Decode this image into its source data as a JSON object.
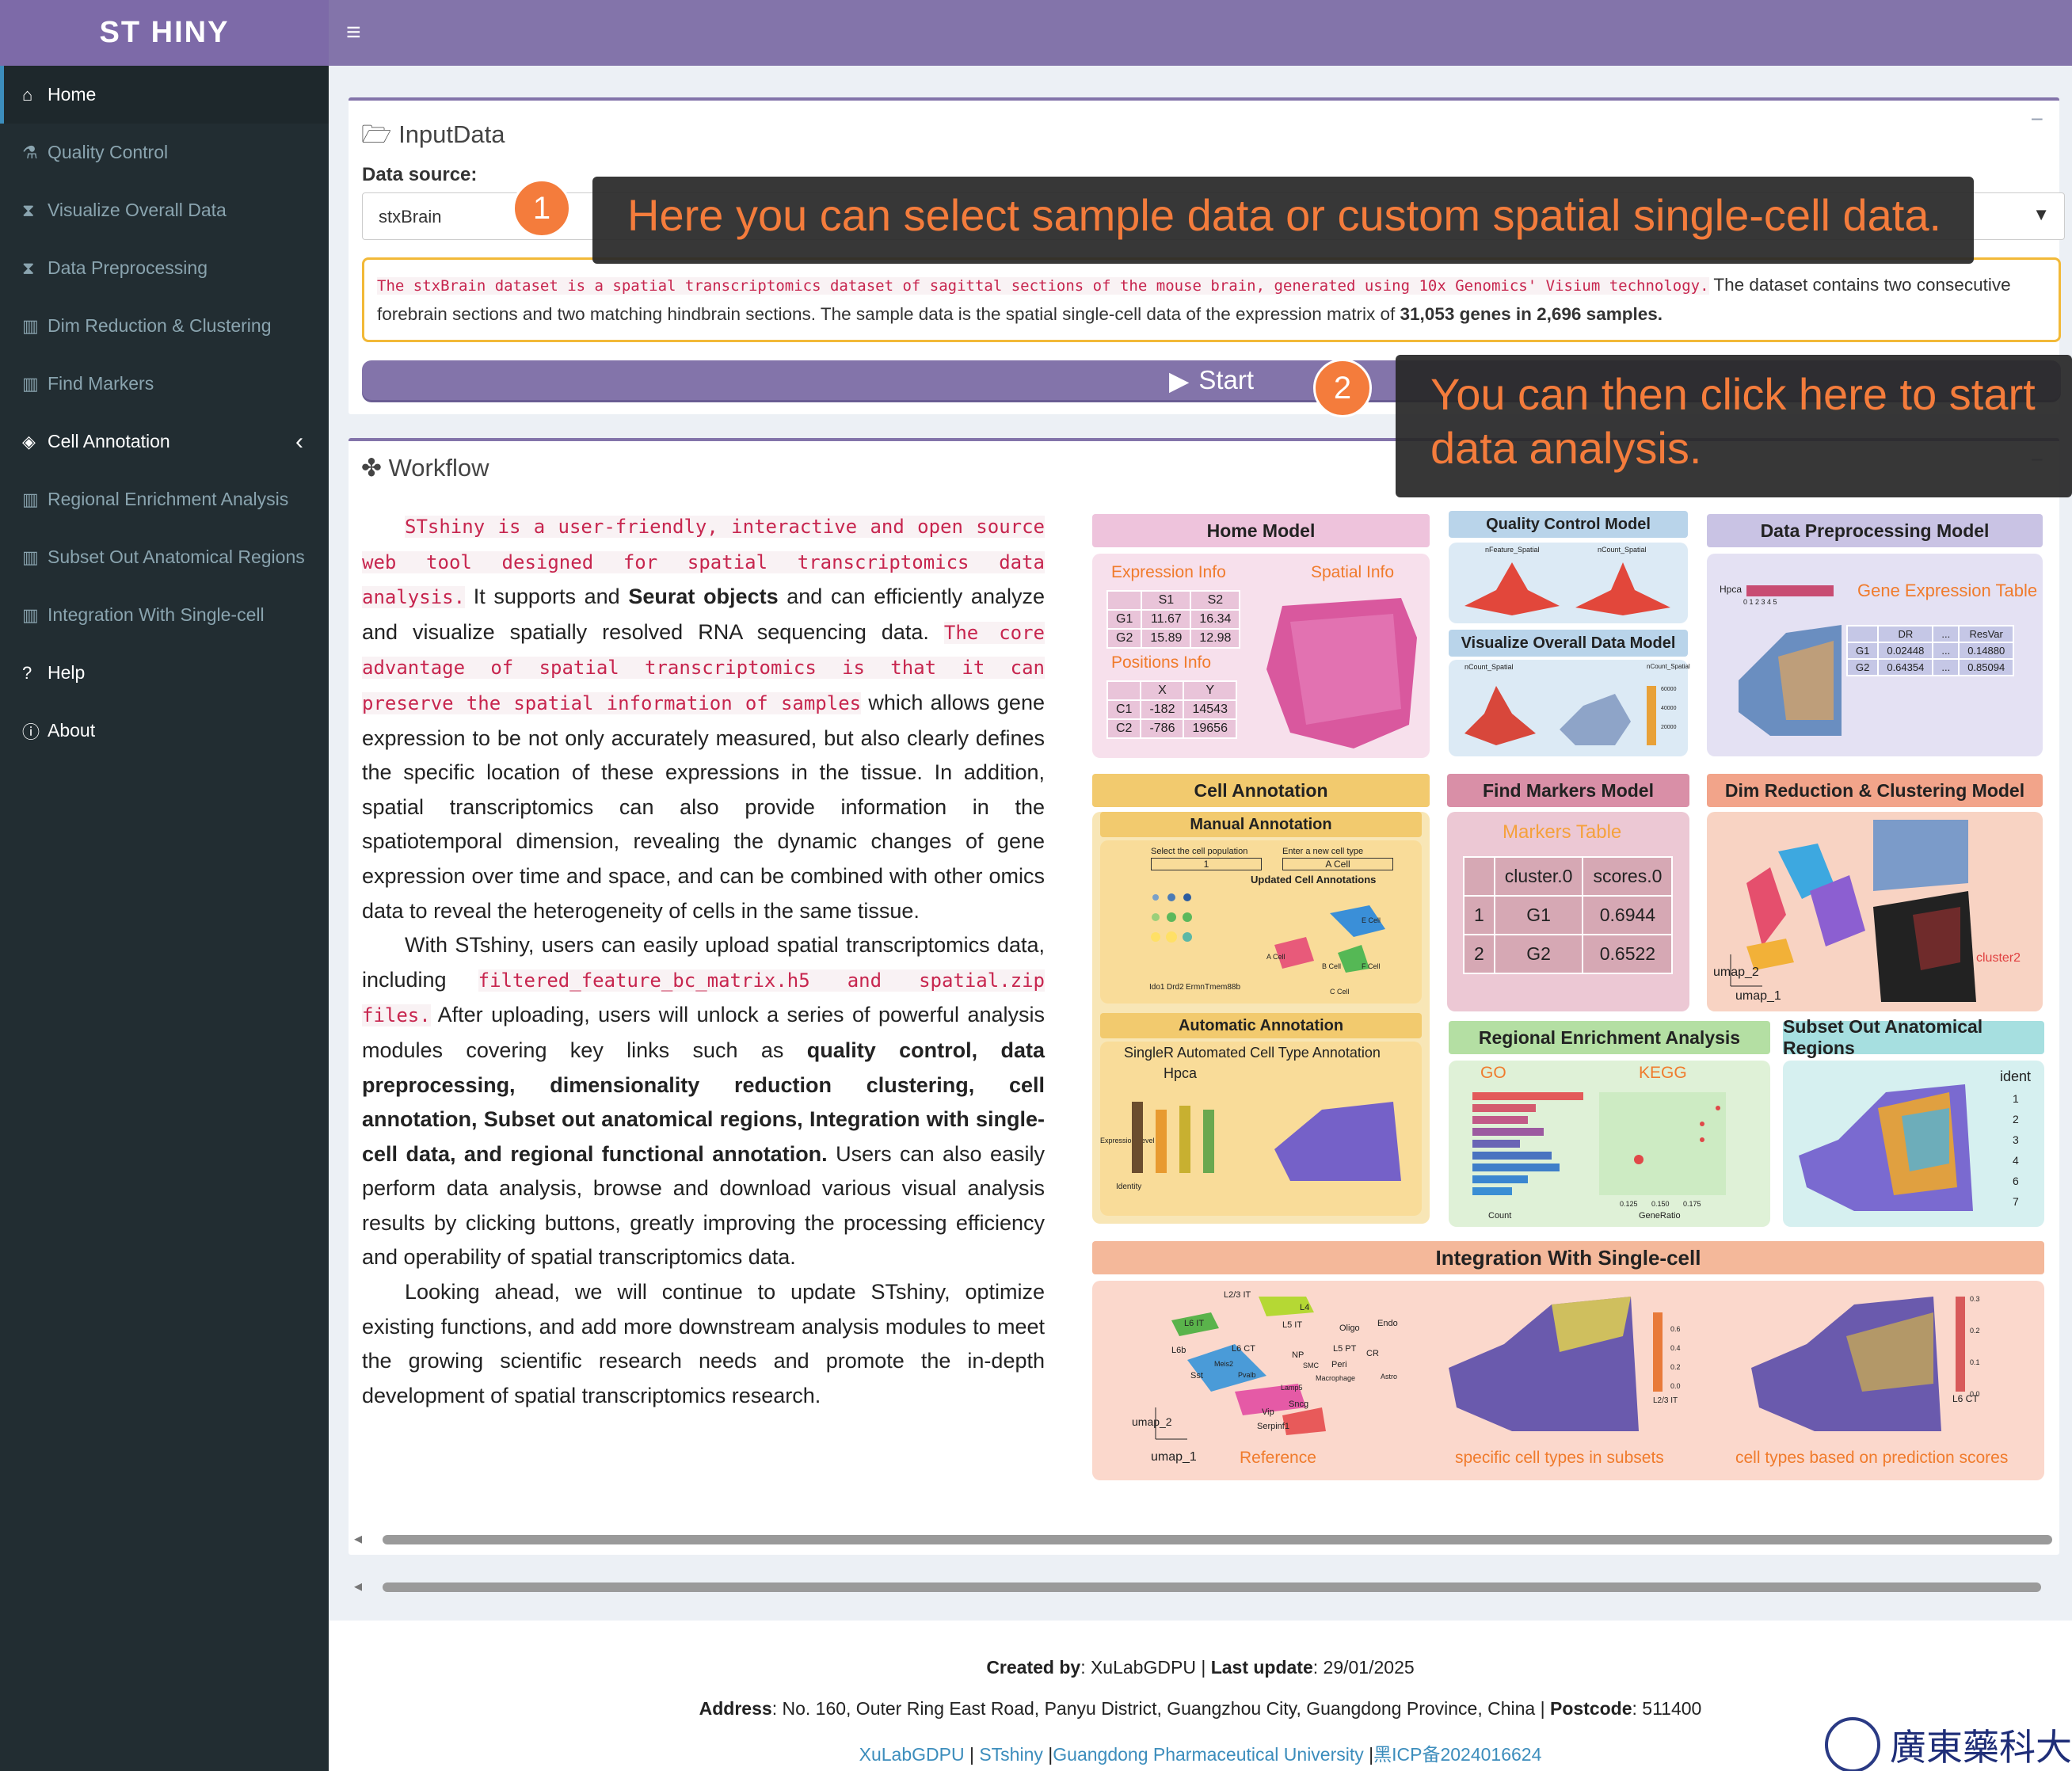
{
  "app": {
    "logo": "ST HINY"
  },
  "sidebar": {
    "items": [
      {
        "label": "Home",
        "icon": "home-icon"
      },
      {
        "label": "Quality Control",
        "icon": "flask-icon"
      },
      {
        "label": "Visualize Overall Data",
        "icon": "hourglass-icon"
      },
      {
        "label": "Data Preprocessing",
        "icon": "hourglass-icon"
      },
      {
        "label": "Dim Reduction & Clustering",
        "icon": "bar-chart-icon"
      },
      {
        "label": "Find Markers",
        "icon": "bar-chart-icon"
      },
      {
        "label": "Cell Annotation",
        "icon": "tags-icon"
      },
      {
        "label": "Regional Enrichment Analysis",
        "icon": "bar-chart-icon"
      },
      {
        "label": "Subset Out Anatomical Regions",
        "icon": "bar-chart-icon"
      },
      {
        "label": "Integration With Single-cell",
        "icon": "bar-chart-icon"
      },
      {
        "label": "Help",
        "icon": "question-circle-icon"
      },
      {
        "label": "About",
        "icon": "info-circle-icon"
      }
    ]
  },
  "input_box": {
    "title": "InputData",
    "data_source_label": "Data source:",
    "selected": "stxBrain",
    "note_code": "The stxBrain dataset is a spatial transcriptomics dataset of sagittal sections of the mouse brain, generated using 10x Genomics' Visium technology.",
    "note_text_1": " The dataset contains two consecutive forebrain sections and two matching hindbrain sections. The sample data is the spatial single-cell data of the expression matrix of ",
    "note_bold": "31,053 genes in 2,696 samples.",
    "start_label": "Start"
  },
  "tooltips": {
    "one": {
      "num": "1",
      "text": "Here you can select sample data or custom spatial single-cell data."
    },
    "two": {
      "num": "2",
      "text": "You can then click here to start data analysis."
    }
  },
  "workflow": {
    "title": "Workflow",
    "p1_code1": "STshiny is a user-friendly, interactive and open source web tool designed for spatial transcriptomics data analysis.",
    "p1_t1": " It supports and ",
    "p1_b1": "Seurat objects",
    "p1_t2": " and can efficiently analyze and visualize spatially resolved RNA sequencing data. ",
    "p1_code2": "The core advantage of spatial transcriptomics is that it can preserve the spatial information of samples",
    "p1_t3": " which allows gene expression to be not only accurately measured, but also clearly defines the specific location of these expressions in the tissue. In addition, spatial transcriptomics can also provide information in the spatiotemporal dimension, revealing the dynamic changes of gene expression over time and space, and can be combined with other omics data to reveal the heterogeneity of cells in the same tissue.",
    "p2_t1": "With STshiny, users can easily upload spatial transcriptomics data, including ",
    "p2_code": "filtered_feature_bc_matrix.h5 and spatial.zip files.",
    "p2_t2": " After uploading, users will unlock a series of powerful analysis modules covering key links such as ",
    "p2_b": "quality control, data preprocessing, dimensionality reduction clustering, cell annotation, Subset out anatomical regions, Integration with single-cell data, and regional functional annotation.",
    "p2_t3": " Users can also easily perform data analysis, browse and download various visual analysis results by clicking buttons, greatly improving the processing efficiency and operability of spatial transcriptomics data.",
    "p3": "Looking ahead, we will continue to update STshiny, optimize existing functions, and add more downstream analysis modules to meet the growing scientific research needs and promote the in-depth development of spatial transcriptomics research."
  },
  "diagram": {
    "home": "Home Model",
    "expr": "Expression Info",
    "spatial": "Spatial Info",
    "pos": "Positions Info",
    "expr_table": [
      [
        "",
        "S1",
        "S2"
      ],
      [
        "G1",
        "11.67",
        "16.34"
      ],
      [
        "G2",
        "15.89",
        "12.98"
      ]
    ],
    "pos_table": [
      [
        "",
        "X",
        "Y"
      ],
      [
        "C1",
        "-182",
        "14543"
      ],
      [
        "C2",
        "-786",
        "19656"
      ]
    ],
    "qc": "Quality Control Model",
    "qc_sub1": "nFeature_Spatial",
    "qc_sub2": "nCount_Spatial",
    "vis": "Visualize Overall Data Model",
    "vis_sub1": "nCount_Spatial",
    "vis_sub2": "nCount_Spatial",
    "vis_ticks": [
      "60000",
      "40000",
      "20000"
    ],
    "prep": "Data Preprocessing Model",
    "hpca": "Hpca",
    "hpca_ticks": "0 1 2 3 4 5",
    "gene_table_title": "Gene Expression Table",
    "gene_table": [
      [
        "",
        "DR",
        "...",
        "ResVar"
      ],
      [
        "G1",
        "0.02448",
        "...",
        "0.14880"
      ],
      [
        "G2",
        "0.64354",
        "...",
        "0.85094"
      ]
    ],
    "cell": "Cell Annotation",
    "manual": "Manual Annotation",
    "manual_sel": "Select the cell population",
    "manual_new": "Enter a new cell type",
    "manual_sel_val": "1",
    "manual_new_val": "A Cell",
    "updated": "Updated Cell Annotations",
    "dot_labels": [
      "Ido1",
      "Drd2",
      "Ermn",
      "Tmem88b"
    ],
    "cluster_labels": [
      "A Cell",
      "E Cell",
      "B Cell",
      "F Cell",
      "C Cell"
    ],
    "auto": "Automatic Annotation",
    "singler": "SingleR Automated Cell Type Annotation",
    "singler_hpca": "Hpca",
    "identity": "Identity",
    "expr_level": "Expression Level",
    "markers": "Find Markers Model",
    "markers_title": "Markers Table",
    "markers_table": [
      [
        "",
        "cluster.0",
        "scores.0"
      ],
      [
        "1",
        "G1",
        "0.6944"
      ],
      [
        "2",
        "G2",
        "0.6522"
      ]
    ],
    "dim": "Dim Reduction & Clustering Model",
    "umap1": "umap_1",
    "umap2": "umap_2",
    "cluster2": "cluster2",
    "enrich": "Regional Enrichment Analysis",
    "go": "GO",
    "kegg": "KEGG",
    "count": "Count",
    "generatio": "GeneRatio",
    "generatio_ticks": [
      "0.125",
      "0.150",
      "0.175"
    ],
    "subset": "Subset Out Anatomical Regions",
    "ident": "ident",
    "ident_levels": [
      "1",
      "2",
      "3",
      "4",
      "6",
      "7"
    ],
    "integ": "Integration With Single-cell",
    "integ_labels": [
      "L2/3 IT",
      "L4",
      "L5 IT",
      "L6 IT",
      "L6b",
      "L6 CT",
      "Oligo",
      "Endo",
      "NP",
      "L5 PT",
      "CR",
      "Meis2",
      "SMC",
      "Peri",
      "Sst",
      "Pvalb",
      "Macrophage",
      "Astro",
      "Lamp5",
      "Sncg",
      "Vip",
      "Serpinf1"
    ],
    "ref": "Reference",
    "specific": "specific cell types in subsets",
    "based": "cell types based on prediction scores",
    "integ_scale1": [
      "0.6",
      "0.4",
      "0.2",
      "0.0"
    ],
    "integ_scale2": [
      "0.3",
      "0.2",
      "0.1",
      "0.0"
    ],
    "l23": "L2/3 IT",
    "l6ct": "L6 CT"
  },
  "footer": {
    "created_label": "Created by",
    "created": ": XuLabGDPU | ",
    "update_label": "Last update",
    "update": ": 29/01/2025",
    "addr_label": "Address",
    "addr": ": No. 160, Outer Ring East Road, Panyu District, Guangzhou City, Guangdong Province, China | ",
    "post_label": "Postcode",
    "post": ": 511400",
    "link1": "XuLabGDPU",
    "link2": "STshiny",
    "link3": "Guangdong Pharmaceutical University",
    "link4": "黑ICP备2024016624",
    "univ": "廣東藥科大"
  },
  "colors": {
    "accent": "#8374aa",
    "sidebar": "#222d32",
    "highlight": "#f47c3c",
    "warning": "#f2b938"
  }
}
